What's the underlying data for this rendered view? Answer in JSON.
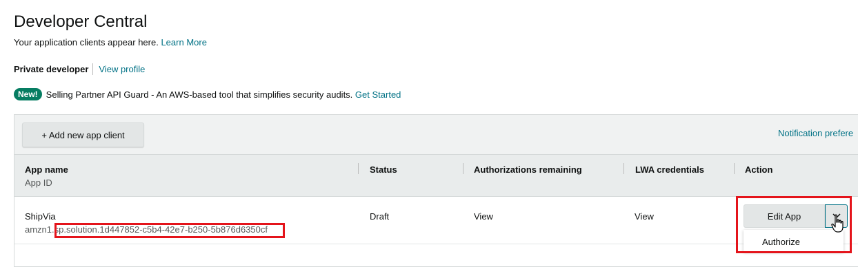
{
  "header": {
    "title": "Developer Central",
    "subtitle": "Your application clients appear here.",
    "learn_more": "Learn More"
  },
  "developer": {
    "type": "Private developer",
    "view_profile": "View profile"
  },
  "announcement": {
    "badge": "New!",
    "text": "Selling Partner API Guard - An AWS-based tool that simplifies security audits.",
    "link": "Get Started"
  },
  "toolbar": {
    "add_button": "+ Add new app client",
    "notifications_link": "Notification prefere"
  },
  "table": {
    "columns": {
      "app_name": "App name",
      "app_id": "App ID",
      "status": "Status",
      "authorizations": "Authorizations remaining",
      "lwa": "LWA credentials",
      "action": "Action"
    },
    "rows": [
      {
        "app_name": "ShipVia",
        "app_id": "amzn1.sp.solution.1d447852-c5b4-42e7-b250-5b876d6350cf",
        "status": "Draft",
        "authorizations": "View",
        "lwa": "View",
        "edit_button": "Edit App",
        "dropdown_items": [
          "Authorize"
        ]
      }
    ]
  },
  "colors": {
    "link": "#007185",
    "badge": "#067d62",
    "highlight": "#e4141b"
  },
  "icons": {
    "dropdown": "chevron-down-icon",
    "cursor": "hand-pointer-icon"
  }
}
